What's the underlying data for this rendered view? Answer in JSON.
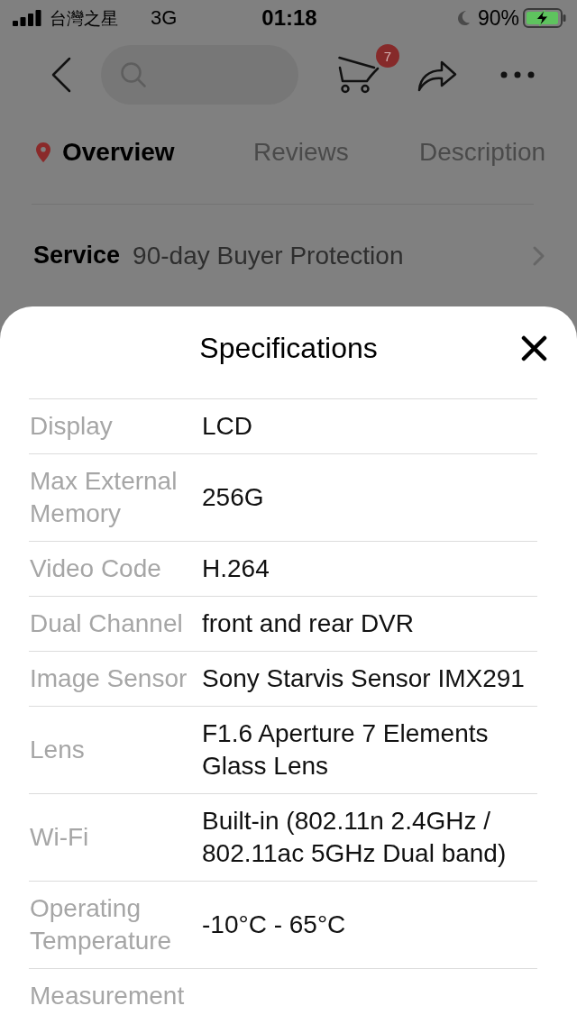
{
  "status_bar": {
    "carrier": "台灣之星",
    "network": "3G",
    "time": "01:18",
    "battery": "90%"
  },
  "nav_bar": {
    "cart_count": "7"
  },
  "tabs": [
    {
      "label": "Overview",
      "selected": true
    },
    {
      "label": "Reviews",
      "selected": false
    },
    {
      "label": "Description",
      "selected": false
    }
  ],
  "service": {
    "label": "Service",
    "value": "90-day Buyer Protection"
  },
  "specifications": {
    "title": "Specifications",
    "rows": [
      {
        "label": "Display",
        "value": "LCD"
      },
      {
        "label": "Max External Memory",
        "value": "256G"
      },
      {
        "label": "Video Code",
        "value": "H.264"
      },
      {
        "label": "Dual Channel",
        "value": "front and rear DVR"
      },
      {
        "label": "Image Sensor",
        "value": "Sony Starvis Sensor IMX291"
      },
      {
        "label": "Lens",
        "value": "F1.6 Aperture 7 Elements Glass Lens"
      },
      {
        "label": "Wi-Fi",
        "value": "Built-in (802.11n 2.4GHz / 802.11ac 5GHz Dual band)"
      },
      {
        "label": "Operating Temperature",
        "value": "-10°C - 65°C"
      },
      {
        "label": "Measurement"
      }
    ]
  }
}
